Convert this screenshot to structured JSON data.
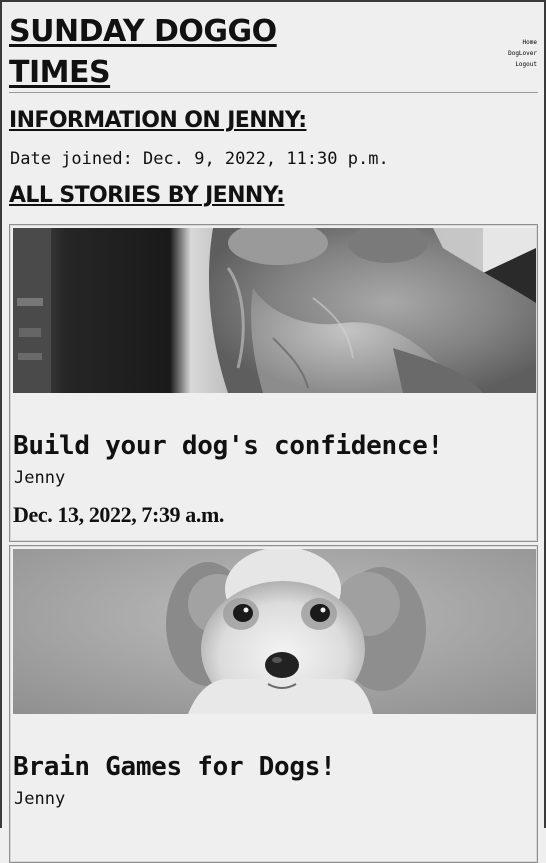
{
  "site": {
    "title": "SUNDAY DOGGO TIMES"
  },
  "nav": {
    "items": [
      "Home",
      "DogLover",
      "Logout"
    ]
  },
  "profile": {
    "heading": "INFORMATION ON JENNY:",
    "date_joined": "Date joined: Dec. 9, 2022, 11:30 p.m."
  },
  "stories": {
    "heading": "ALL STORIES BY JENNY:",
    "items": [
      {
        "title": "Build your dog's confidence!",
        "author": "Jenny",
        "date": "Dec. 13, 2022, 7:39 a.m."
      },
      {
        "title": "Brain Games for Dogs!",
        "author": "Jenny"
      }
    ]
  }
}
